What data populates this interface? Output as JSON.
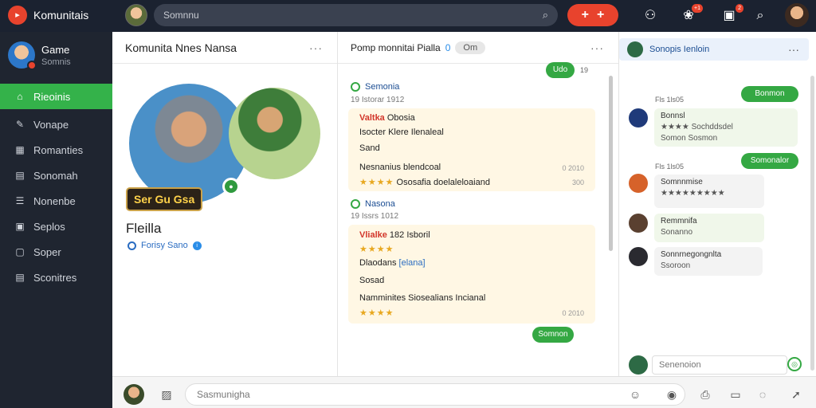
{
  "app": {
    "name": "Komunitais",
    "logo_glyph": "▸"
  },
  "search": {
    "placeholder": "Somnnu"
  },
  "top_icons": {
    "add": "+",
    "user": "👤",
    "chat_badge": "+1",
    "gift_badge": "2"
  },
  "sidebar": {
    "profile": {
      "name": "Game",
      "sub": "Somnis"
    },
    "items": [
      {
        "label": "Rieoinis",
        "icon": "home-icon",
        "glyph": "⌂",
        "active": true
      },
      {
        "label": "Vonape",
        "icon": "pencil-icon",
        "glyph": "✎"
      },
      {
        "label": "Romanties",
        "icon": "chart-icon",
        "glyph": "▦"
      },
      {
        "label": "Sonomah",
        "icon": "grid-icon",
        "glyph": "▤"
      },
      {
        "label": "Nonenbe",
        "icon": "list-icon",
        "glyph": "☰"
      },
      {
        "label": "Seplos",
        "icon": "box-icon",
        "glyph": "▣"
      },
      {
        "label": "Soper",
        "icon": "document-icon",
        "glyph": "▢"
      },
      {
        "label": "Sconitres",
        "icon": "table-icon",
        "glyph": "▤"
      }
    ]
  },
  "col1": {
    "title": "Komunita Nnes Nansa",
    "hero_tag": "Ser Gu Gsa",
    "hero_title": "Fleilla",
    "hero_sub": "Forisy Sano"
  },
  "col2": {
    "head_text": "Pomp monnitai Pialla",
    "head_count": "0",
    "head_pill": "Om",
    "top_pill": "Udo",
    "top_pill_meta": "19",
    "posts": [
      {
        "author": "Semonia",
        "meta": "19 Istorar 1912",
        "lead": "Valtka",
        "lead_rest": "Obosia",
        "line2": "Isocter Klere Ilenaleal",
        "line3": "Sand",
        "line4": "Nesnanius blendcoal",
        "line4_meta": "0 2010",
        "stars": "★★★★",
        "line5": "Ososafia doelaleloaiand",
        "line5_meta": "300"
      },
      {
        "author": "Nasona",
        "meta": "19 Issrs 1012",
        "lead": "Vlialke",
        "lead_rest": "182 Isboril",
        "stars": "★★★★",
        "line3": "Dlaodans",
        "line3_link": "[elana]",
        "line4": "Sosad",
        "line5": "Namminites Siosealians Incianal",
        "stars2": "★★★★",
        "line6_meta": "0 2010"
      }
    ],
    "bottom_pill": "Somnon"
  },
  "col3": {
    "title": "Sonopis Ienloin",
    "messages": [
      {
        "text": "Bonmon",
        "time": "Fls 1ls05",
        "line1": "Bonnsl",
        "line2": "★★★★ Sochddsdel"
      },
      {
        "line3": "Somon Sosmon"
      },
      {
        "text": "Somonalor",
        "time": "Fls 1ls05"
      },
      {
        "line1": "Somnnmise",
        "line2": "★★★★★★★★★"
      },
      {
        "line1": "Remmnifa",
        "line2": "Sonanno"
      },
      {
        "line1": "Sonnrnegongnlta",
        "line2": "Ssoroon"
      }
    ],
    "chat_placeholder": "Senenoion"
  },
  "composer": {
    "placeholder": "Sasmunigha"
  }
}
